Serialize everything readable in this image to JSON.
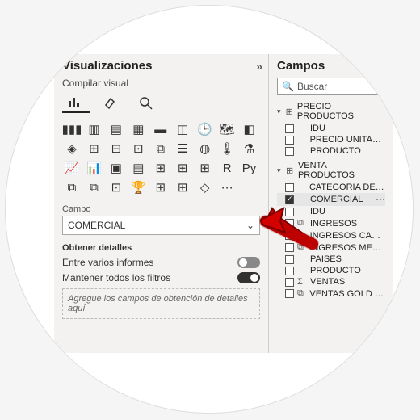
{
  "vis": {
    "title": "Visualizaciones",
    "subtitle": "Compilar visual",
    "tabs": [
      "build",
      "format",
      "analytics"
    ],
    "field_label": "Campo",
    "field_value": "COMERCIAL",
    "details_title": "Obtener detalles",
    "toggle1_label": "Entre varios informes",
    "toggle2_label": "Mantener todos los filtros",
    "drill_placeholder": "Agregue los campos de obtención de detalles aquí",
    "viz_icons": [
      "▮▮▮",
      "▥",
      "▤",
      "▦",
      "▬",
      "◫",
      "🕒",
      "🗺",
      "◧",
      "◈",
      "⊞",
      "⊟",
      "⊡",
      "⧉",
      "☰",
      "◍",
      "🌡",
      "⚗",
      "📈",
      "📊",
      "▣",
      "▤",
      "⊞",
      "⊞",
      "⊞",
      "R",
      "Py",
      "⧉",
      "⧉",
      "⊡",
      "🏆",
      "⊞",
      "⊞",
      "◇",
      "⋯"
    ]
  },
  "fields": {
    "title": "Campos",
    "search_placeholder": "Buscar",
    "groups": [
      {
        "name": "PRECIO PRODUCTOS",
        "items": [
          {
            "label": "IDU",
            "type": "",
            "checked": false
          },
          {
            "label": "PRECIO UNITARIO",
            "type": "",
            "checked": false
          },
          {
            "label": "PRODUCTO",
            "type": "",
            "checked": false
          }
        ]
      },
      {
        "name": "VENTA PRODUCTOS",
        "items": [
          {
            "label": "CATEGORÍA DE P…",
            "type": "",
            "checked": false
          },
          {
            "label": "COMERCIAL",
            "type": "",
            "checked": true,
            "sel": true
          },
          {
            "label": "IDU",
            "type": "",
            "checked": false
          },
          {
            "label": "INGRESOS",
            "type": "calc",
            "checked": false
          },
          {
            "label": "INGRESOS CAM…",
            "type": "calc",
            "checked": false
          },
          {
            "label": "INGRESOS MEDI…",
            "type": "calc",
            "checked": false
          },
          {
            "label": "PAISES",
            "type": "",
            "checked": false
          },
          {
            "label": "PRODUCTO",
            "type": "",
            "checked": false
          },
          {
            "label": "VENTAS",
            "type": "sum",
            "checked": false
          },
          {
            "label": "VENTAS GOLD P…",
            "type": "calc",
            "checked": false
          }
        ]
      }
    ]
  }
}
